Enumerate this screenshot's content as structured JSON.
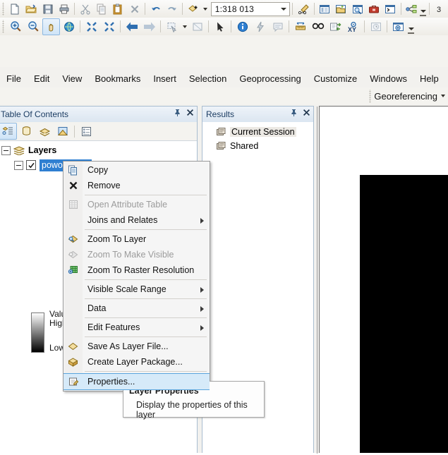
{
  "toolbars": {
    "standard": {
      "scale_value": "1:318 013",
      "buttons": [
        {
          "name": "new-map-icon",
          "label": "New"
        },
        {
          "name": "open-icon",
          "label": "Open"
        },
        {
          "name": "save-icon",
          "label": "Save"
        },
        {
          "name": "print-icon",
          "label": "Print"
        },
        {
          "name": "cut-icon",
          "label": "Cut"
        },
        {
          "name": "copy-icon",
          "label": "Copy"
        },
        {
          "name": "paste-icon",
          "label": "Paste"
        },
        {
          "name": "delete-icon",
          "label": "Delete"
        },
        {
          "name": "undo-icon",
          "label": "Undo"
        },
        {
          "name": "redo-icon",
          "label": "Redo"
        },
        {
          "name": "add-data-icon",
          "label": "Add Data"
        },
        {
          "name": "editor-toolbar-icon",
          "label": "Editor Toolbar"
        },
        {
          "name": "table-of-contents-icon",
          "label": "Table Of Contents"
        },
        {
          "name": "catalog-icon",
          "label": "Catalog"
        },
        {
          "name": "search-window-icon",
          "label": "Search"
        },
        {
          "name": "toolbox-icon",
          "label": "ArcToolbox"
        },
        {
          "name": "python-window-icon",
          "label": "Python Window"
        },
        {
          "name": "model-builder-icon",
          "label": "ModelBuilder"
        }
      ]
    },
    "tools": {
      "buttons": [
        {
          "name": "zoom-in-icon",
          "label": "Zoom In",
          "active": false
        },
        {
          "name": "zoom-out-icon",
          "label": "Zoom Out",
          "active": false
        },
        {
          "name": "pan-icon",
          "label": "Pan",
          "active": true
        },
        {
          "name": "full-extent-icon",
          "label": "Full Extent",
          "active": false
        },
        {
          "name": "fixed-zoom-in-icon",
          "label": "Fixed Zoom In",
          "active": false
        },
        {
          "name": "fixed-zoom-out-icon",
          "label": "Fixed Zoom Out",
          "active": false
        },
        {
          "name": "go-back-extent-icon",
          "label": "Go Back To Previous Extent",
          "active": false
        },
        {
          "name": "go-forward-extent-icon",
          "label": "Go To Next Extent",
          "active": false
        },
        {
          "name": "select-features-icon",
          "label": "Select Features",
          "active": false
        },
        {
          "name": "clear-selection-icon",
          "label": "Clear Selected Features",
          "active": false
        },
        {
          "name": "select-elements-icon",
          "label": "Select Elements",
          "active": false
        },
        {
          "name": "identify-icon",
          "label": "Identify",
          "active": false
        },
        {
          "name": "hyperlink-icon",
          "label": "Hyperlink",
          "active": false
        },
        {
          "name": "html-popup-icon",
          "label": "HTML Popup",
          "active": false
        },
        {
          "name": "measure-icon",
          "label": "Measure",
          "active": false
        },
        {
          "name": "find-icon",
          "label": "Find",
          "active": false
        },
        {
          "name": "find-route-icon",
          "label": "Find Route",
          "active": false
        },
        {
          "name": "go-to-xy-icon",
          "label": "Go To XY",
          "active": false
        },
        {
          "name": "time-slider-icon",
          "label": "Time Slider",
          "active": false
        },
        {
          "name": "create-viewer-window-icon",
          "label": "Create Viewer Window",
          "active": false
        }
      ]
    },
    "georeferencing": {
      "label": "Georeferencing",
      "dropdown_icon": "chevron-down-icon"
    }
  },
  "menubar": {
    "items": [
      {
        "label": "File"
      },
      {
        "label": "Edit"
      },
      {
        "label": "View"
      },
      {
        "label": "Bookmarks"
      },
      {
        "label": "Insert"
      },
      {
        "label": "Selection"
      },
      {
        "label": "Geoprocessing"
      },
      {
        "label": "Customize"
      },
      {
        "label": "Windows"
      },
      {
        "label": "Help"
      }
    ]
  },
  "toc": {
    "title": "Table Of Contents",
    "pin_icon": "pin-icon",
    "close_icon": "close-icon",
    "tools": [
      {
        "name": "list-by-drawing-order-icon",
        "selected": true
      },
      {
        "name": "list-by-source-icon",
        "selected": false
      },
      {
        "name": "list-by-visibility-icon",
        "selected": false
      },
      {
        "name": "list-by-selection-icon",
        "selected": false
      },
      {
        "name": "options-icon",
        "selected": false
      }
    ],
    "root": {
      "label": "Layers"
    },
    "layer": {
      "label": "powodz.img",
      "checked": true,
      "selected": true
    },
    "legend": {
      "value_label": "Value",
      "high_label": "High",
      "low_label": "Low",
      "ramp_top_color": "#ffffff",
      "ramp_bottom_color": "#000000"
    }
  },
  "results": {
    "title": "Results",
    "pin_icon": "pin-icon",
    "close_icon": "close-icon",
    "items": [
      {
        "label": "Current Session",
        "icon": "results-folder-icon",
        "highlighted": true
      },
      {
        "label": "Shared",
        "icon": "results-folder-icon",
        "highlighted": false
      }
    ]
  },
  "map": {
    "raster_color": "#000000",
    "background_color": "#ffffff"
  },
  "context_menu": {
    "items": [
      {
        "label": "Copy",
        "icon": "copy-icon",
        "disabled": false,
        "submenu": false,
        "highlighted": false,
        "sep_after": false
      },
      {
        "label": "Remove",
        "icon": "remove-x-icon",
        "disabled": false,
        "submenu": false,
        "highlighted": false,
        "sep_after": true
      },
      {
        "label": "Open Attribute Table",
        "icon": "attribute-table-icon",
        "disabled": true,
        "submenu": false,
        "highlighted": false,
        "sep_after": false
      },
      {
        "label": "Joins and Relates",
        "icon": "none",
        "disabled": false,
        "submenu": true,
        "highlighted": false,
        "sep_after": true
      },
      {
        "label": "Zoom To Layer",
        "icon": "zoom-to-layer-icon",
        "disabled": false,
        "submenu": false,
        "highlighted": false,
        "sep_after": false
      },
      {
        "label": "Zoom To Make Visible",
        "icon": "zoom-make-visible-icon",
        "disabled": true,
        "submenu": false,
        "highlighted": false,
        "sep_after": false
      },
      {
        "label": "Zoom To Raster Resolution",
        "icon": "zoom-raster-resolution-icon",
        "disabled": false,
        "submenu": false,
        "highlighted": false,
        "sep_after": true
      },
      {
        "label": "Visible Scale Range",
        "icon": "none",
        "disabled": false,
        "submenu": true,
        "highlighted": false,
        "sep_after": true
      },
      {
        "label": "Data",
        "icon": "none",
        "disabled": false,
        "submenu": true,
        "highlighted": false,
        "sep_after": true
      },
      {
        "label": "Edit Features",
        "icon": "none",
        "disabled": false,
        "submenu": true,
        "highlighted": false,
        "sep_after": true
      },
      {
        "label": "Save As Layer File...",
        "icon": "layer-file-icon",
        "disabled": false,
        "submenu": false,
        "highlighted": false,
        "sep_after": false
      },
      {
        "label": "Create Layer Package...",
        "icon": "layer-package-icon",
        "disabled": false,
        "submenu": false,
        "highlighted": false,
        "sep_after": true
      },
      {
        "label": "Properties...",
        "icon": "properties-icon",
        "disabled": false,
        "submenu": false,
        "highlighted": true,
        "sep_after": false
      }
    ]
  },
  "tooltip": {
    "title": "Layer Properties",
    "body": "Display the properties of this layer"
  },
  "colors": {
    "selection_blue": "#2f7fd1",
    "highlight_blue": "#d6eaf9",
    "panel_header": "#dbe6f1"
  }
}
